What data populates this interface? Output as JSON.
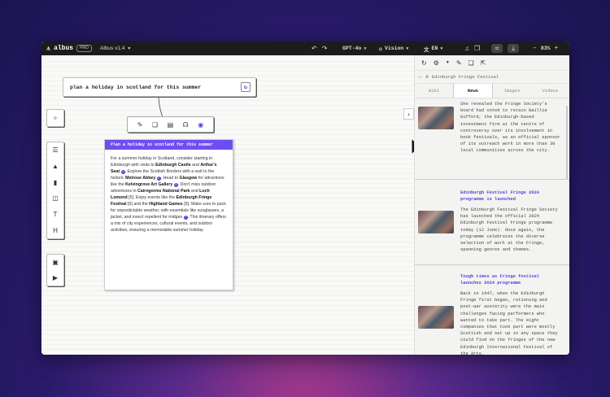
{
  "topbar": {
    "brand": "albus",
    "pro_badge": "PRO",
    "version_label": "Albus v1.4",
    "model": "GPT-4o",
    "vision_label": "Vision",
    "language": "EN",
    "zoom": "83%"
  },
  "canvas": {
    "prompt_text": "plan a holiday in scotland for this summer",
    "card": {
      "title": "Plan a holiday in scotland for this summer",
      "body": {
        "t1": "For a summer holiday in Scotland, consider starting in Edinburgh with visits to ",
        "b1": "Edinburgh Castle",
        "t2": " and ",
        "b2": "Arthur's Seat",
        "c1": "1",
        "t3": ". Explore the Scottish Borders with a visit to the historic ",
        "b3": "Melrose Abbey",
        "c2": "2",
        "t4": ". Head to ",
        "b4": "Glasgow",
        "t5": " for attractions like the ",
        "b5": "Kelvingrove Art Gallery",
        "c3": "3",
        "t6": ". Don't miss outdoor adventures in ",
        "b6": "Cairngorms National Park",
        "t7": " and ",
        "b7": "Loch Lomond",
        "t8": " [5]. Enjoy events like the ",
        "b8": "Edinburgh Fringe Festival",
        "t9": " [6] and the ",
        "b9": "Highland Games",
        "t10": " [9]. Make sure to pack for unpredictable weather, with essentials like sunglasses, a jacket, and insect repellent for midges ",
        "c4": "7",
        "t11": ". This itinerary offers a mix of city experiences, cultural events, and outdoor activities, ensuring a memorable summer holiday."
      }
    }
  },
  "panel": {
    "url": "Edinburgh Fringe Festival",
    "tabs": [
      "Wiki",
      "News",
      "Images",
      "Videos"
    ],
    "active_tab": "News",
    "news": [
      {
        "title": "",
        "desc": "She revealed the Fringe Society's board had voted to retain Baillie Gifford, the Edinburgh-based investment firm at the centre of controversy over its involvement in book festivals, as an official sponsor of its outreach work in more than 30 local communities across the city."
      },
      {
        "title": "Edinburgh Festival Fringe 2024 programme is launched",
        "desc": "The Edinburgh Festival Fringe Society has launched the official 2024 Edinburgh Festival Fringe programme today (12 June). Once again, the programme celebrates the diverse selection of work at the Fringe, spanning genres and themes."
      },
      {
        "title": "Tough times as Fringe festival launches 2024 programme",
        "desc": "Back in 1947, when the Edinburgh Fringe first began, rationing and post-war austerity were the main challenges facing performers who wanted to take part. The eight companies that took part were mostly Scottish and set up in any space they could find on the fringes of the new Edinburgh International Festival of the Arts."
      }
    ]
  },
  "colors": {
    "accent": "#6f4ef0",
    "topbar_bg": "#1c1c1c",
    "link": "#5a3ee0"
  },
  "icons": [
    "albus-logo-icon",
    "chevron-down-icon",
    "undo-icon",
    "redo-icon",
    "globe-icon",
    "translate-icon",
    "music-icon",
    "layers-icon",
    "chat-icon",
    "download-icon",
    "minus-icon",
    "plus-icon",
    "refresh-icon",
    "sparkle-icon",
    "list-icon",
    "image-icon",
    "document-icon",
    "note-icon",
    "text-icon",
    "heading-icon",
    "photo-icon",
    "video-icon",
    "edit-icon",
    "copy-icon",
    "clipboard-icon",
    "headphones-icon",
    "target-icon",
    "expand-arrow-icon",
    "back-arrow-icon",
    "settings-icon",
    "external-link-icon"
  ]
}
